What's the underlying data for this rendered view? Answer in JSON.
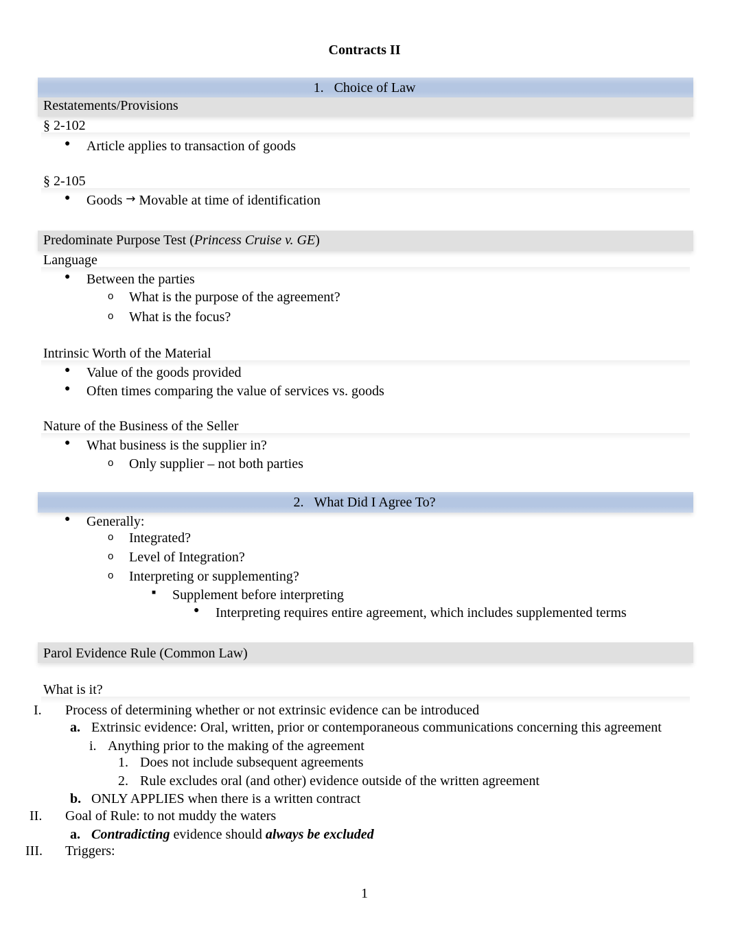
{
  "document": {
    "title": "Contracts II",
    "page_number": "1"
  },
  "section1": {
    "number": "1.",
    "heading": "Choice of Law",
    "subheading": "Restatements/Provisions",
    "provisions": [
      {
        "label": "§ 2-102",
        "bullets": [
          "Article applies to transaction of goods"
        ]
      },
      {
        "label": "§ 2-105",
        "bullet_prefix": "Goods",
        "arrow": "→",
        "bullet_suffix": "Movable at time of identification"
      }
    ],
    "test": {
      "heading_prefix": "Predominate Purpose Test (",
      "heading_case": "Princess Cruise v. GE",
      "heading_suffix": ")",
      "factors": [
        {
          "label": "Language",
          "bullet": "Between the parties",
          "subitems": [
            "What is the purpose of the agreement?",
            "What is the focus?"
          ]
        },
        {
          "label": "Intrinsic Worth of the Material",
          "bullets": [
            "Value of the goods provided",
            "Often times comparing the value of services vs. goods"
          ]
        },
        {
          "label": "Nature of the Business of the Seller",
          "bullet": "What business is the supplier in?",
          "subitems": [
            "Only supplier – not both parties"
          ]
        }
      ]
    }
  },
  "section2": {
    "number": "2.",
    "heading": "What Did I Agree To?",
    "bullet": "Generally:",
    "subitems": [
      "Integrated?",
      "Level of Integration?",
      "Interpreting or supplementing?"
    ],
    "level3": "Supplement before interpreting",
    "level4": "Interpreting requires entire agreement, which includes supplemented terms"
  },
  "parol": {
    "heading": "Parol Evidence Rule (Common Law)",
    "what_label": "What is it?",
    "outline": {
      "I": {
        "marker": "I.",
        "text": "Process of determining whether or not extrinsic evidence can be introduced",
        "a": {
          "marker": "a.",
          "text": "Extrinsic evidence: Oral, written, prior or contemporaneous communications concerning this agreement",
          "i": {
            "marker": "i.",
            "text": "Anything prior to the making of the agreement",
            "items": [
              {
                "marker": "1.",
                "text": "Does not include subsequent agreements"
              },
              {
                "marker": "2.",
                "text": "Rule excludes oral (and other) evidence outside of the written agreement"
              }
            ]
          }
        },
        "b": {
          "marker": "b.",
          "text": "ONLY APPLIES when there is a written contract"
        }
      },
      "II": {
        "marker": "II.",
        "text": "Goal of Rule: to not muddy the waters",
        "a": {
          "marker": "a.",
          "bold_italic_1": "Contradicting",
          "middle": " evidence should ",
          "bold_italic_2": "always be excluded"
        }
      },
      "III": {
        "marker": "III.",
        "text": "Triggers:"
      }
    }
  },
  "markers": {
    "bullet": "●",
    "circle": "o",
    "square": "■"
  }
}
